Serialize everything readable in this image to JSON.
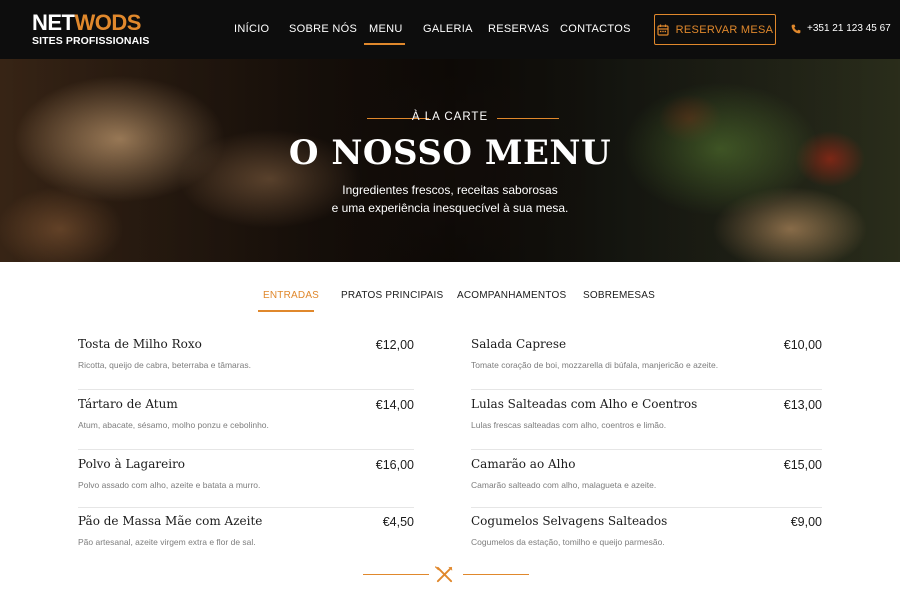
{
  "brand": {
    "name_white": "NET",
    "name_accent": "WODS",
    "tagline": "SITES PROFISSIONAIS"
  },
  "nav": {
    "items": [
      {
        "label": "INÍCIO"
      },
      {
        "label": "SOBRE NÓS"
      },
      {
        "label": "MENU",
        "active": true
      },
      {
        "label": "GALERIA"
      },
      {
        "label": "RESERVAS"
      },
      {
        "label": "CONTACTOS"
      }
    ],
    "reserve_label": "RESERVAR MESA",
    "phone": "+351 21 123 45 67"
  },
  "hero": {
    "kicker": "À LA CARTE",
    "title": "O NOSSO MENU",
    "subtitle_line1": "Ingredientes frescos, receitas saborosas",
    "subtitle_line2": "e uma experiência inesquecível à sua mesa."
  },
  "tabs": [
    {
      "label": "ENTRADAS",
      "active": true
    },
    {
      "label": "PRATOS PRINCIPAIS"
    },
    {
      "label": "ACOMPANHAMENTOS"
    },
    {
      "label": "SOBREMESAS"
    }
  ],
  "menu": {
    "left": [
      {
        "name": "Tosta de Milho Roxo",
        "price": "€12,00",
        "desc": "Ricotta, queijo de cabra, beterraba e tâmaras."
      },
      {
        "name": "Tártaro de Atum",
        "price": "€14,00",
        "desc": "Atum, abacate, sésamo, molho ponzu e cebolinho."
      },
      {
        "name": "Polvo à Lagareiro",
        "price": "€16,00",
        "desc": "Polvo assado com alho, azeite e batata a murro."
      },
      {
        "name": "Pão de Massa Mãe com Azeite",
        "price": "€4,50",
        "desc": "Pão artesanal, azeite virgem extra e flor de sal."
      }
    ],
    "right": [
      {
        "name": "Salada Caprese",
        "price": "€10,00",
        "desc": "Tomate coração de boi, mozzarella di búfala, manjericão e azeite."
      },
      {
        "name": "Lulas Salteadas com Alho e Coentros",
        "price": "€13,00",
        "desc": "Lulas frescas salteadas com alho, coentros e limão."
      },
      {
        "name": "Camarão ao Alho",
        "price": "€15,00",
        "desc": "Camarão salteado com alho, malagueta e azeite."
      },
      {
        "name": "Cogumelos Selvagens Salteados",
        "price": "€9,00",
        "desc": "Cogumelos da estação, tomilho e queijo parmesão."
      }
    ]
  },
  "icons": {
    "calendar": "calendar-icon",
    "phone": "phone-icon",
    "divider": "fork-knife-icon"
  },
  "colors": {
    "accent": "#e0882c",
    "header_bg": "#0d0d0d",
    "text": "#1b1b1b",
    "muted": "#7d7d7d"
  }
}
